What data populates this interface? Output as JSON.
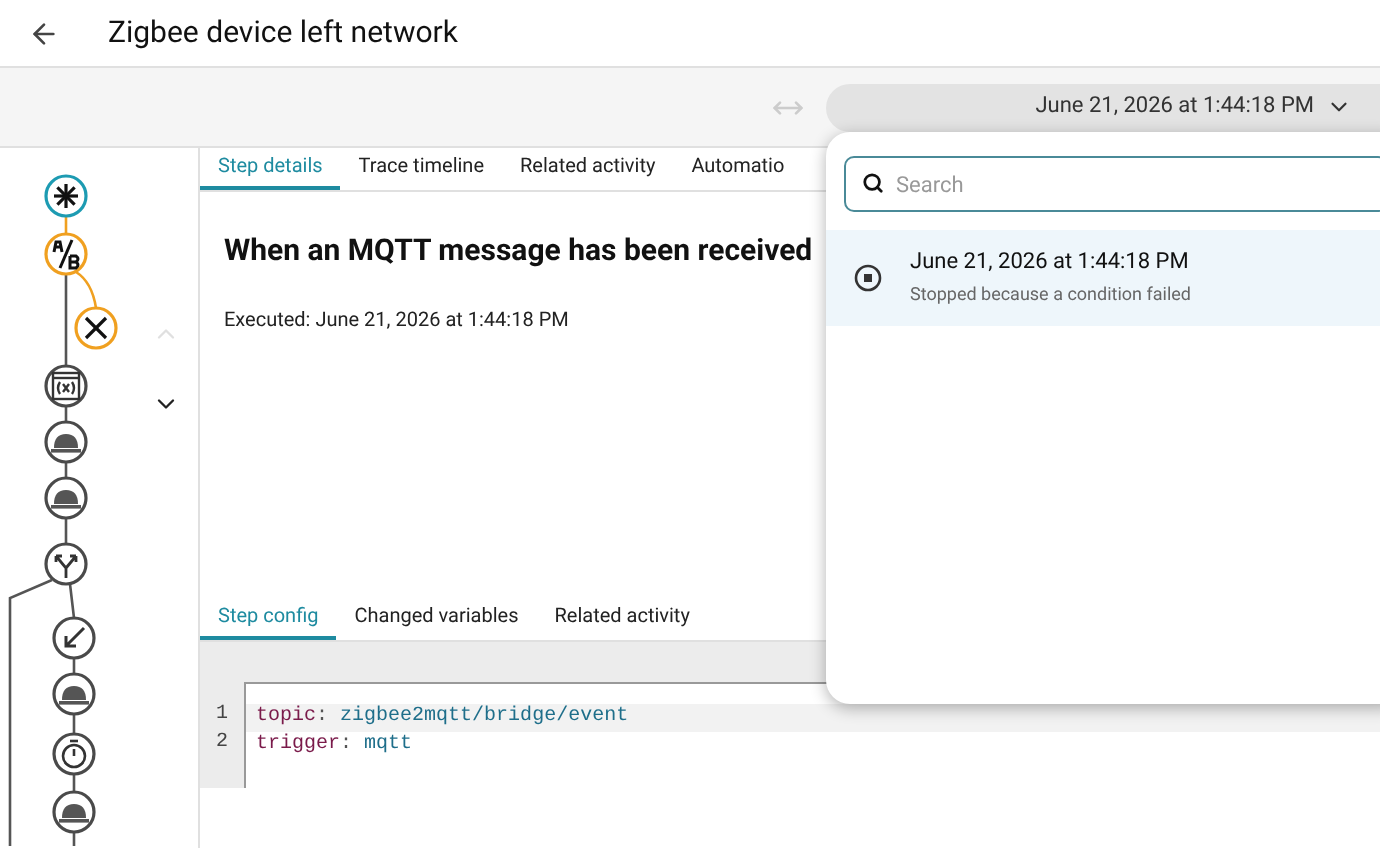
{
  "header": {
    "title": "Zigbee device left network"
  },
  "toolbar": {
    "run_picker": {
      "value": "June 21, 2026 at 1:44:18 PM",
      "expanded": true
    }
  },
  "graph": {
    "nav_up_disabled": true,
    "nodes": [
      {
        "kind": "trigger",
        "color": "#1d9bb2"
      },
      {
        "kind": "condition",
        "color": "#f0a020"
      },
      {
        "kind": "failed",
        "color": "#f0a020"
      },
      {
        "kind": "variables",
        "color": "#4a4a4a"
      },
      {
        "kind": "service",
        "color": "#4a4a4a"
      },
      {
        "kind": "service",
        "color": "#4a4a4a"
      },
      {
        "kind": "choose",
        "color": "#4a4a4a"
      },
      {
        "kind": "arrow",
        "color": "#4a4a4a"
      },
      {
        "kind": "service",
        "color": "#4a4a4a"
      },
      {
        "kind": "delay",
        "color": "#4a4a4a"
      },
      {
        "kind": "service",
        "color": "#4a4a4a"
      }
    ]
  },
  "top_tabs": [
    {
      "label": "Step details",
      "selected": true
    },
    {
      "label": "Trace timeline",
      "selected": false
    },
    {
      "label": "Related activity",
      "selected": false
    },
    {
      "label": "Automatio",
      "selected": false
    }
  ],
  "step": {
    "title": "When an MQTT message has been received",
    "executed": "Executed: June 21, 2026 at 1:44:18 PM"
  },
  "bottom_tabs": [
    {
      "label": "Step config",
      "selected": true
    },
    {
      "label": "Changed variables",
      "selected": false
    },
    {
      "label": "Related activity",
      "selected": false
    }
  ],
  "code_lines": [
    {
      "number": "1",
      "key": "topic",
      "separator": ":",
      "value": "zigbee2mqtt/bridge/event",
      "highlighted": true
    },
    {
      "number": "2",
      "key": "trigger",
      "separator": ":",
      "value": "mqtt",
      "highlighted": false
    }
  ],
  "dropdown": {
    "search": {
      "placeholder": "Search"
    },
    "runs": [
      {
        "title": "June 21, 2026 at 1:44:18 PM",
        "subtitle": "Stopped because a condition failed",
        "selected": true
      }
    ]
  }
}
